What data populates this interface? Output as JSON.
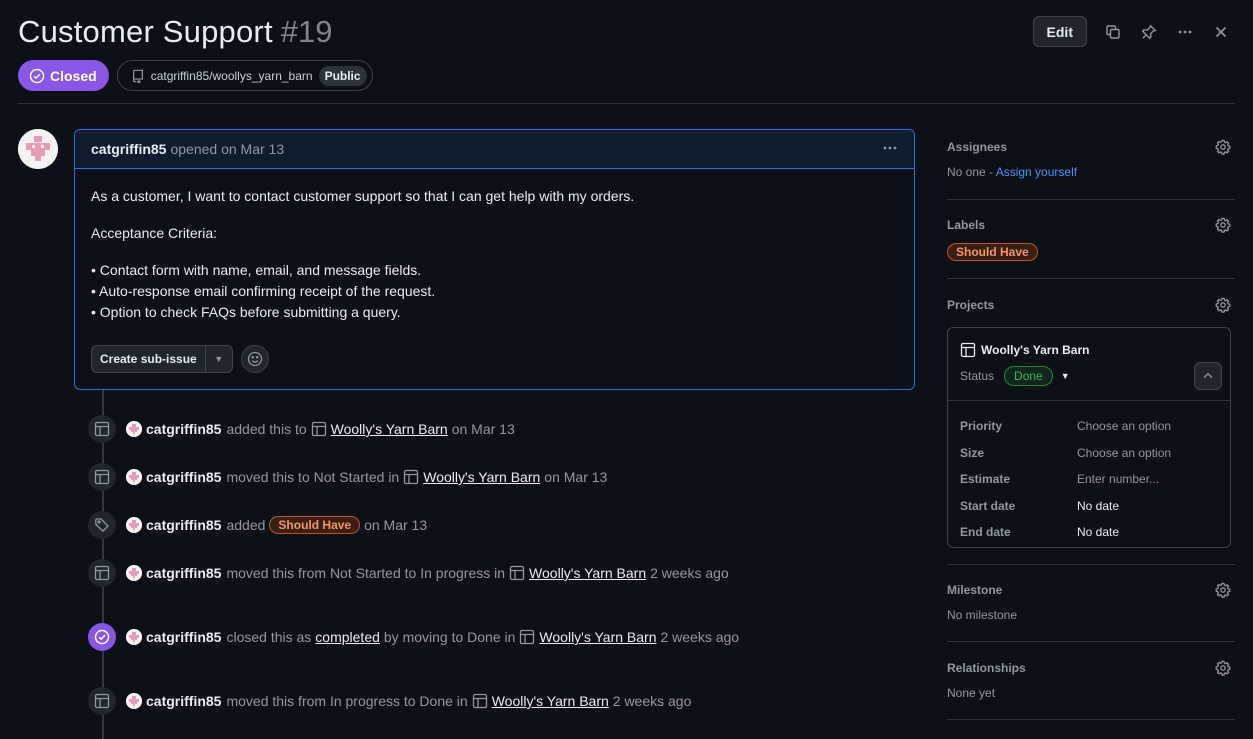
{
  "issue": {
    "title": "Customer Support",
    "number": "#19",
    "state": "Closed",
    "repo": "catgriffin85/woollys_yarn_barn",
    "visibility": "Public"
  },
  "header": {
    "edit_label": "Edit"
  },
  "comment": {
    "author": "catgriffin85",
    "opened_text": "opened on Mar 13",
    "paragraph": "As a customer, I want to contact customer support so that I can get help with my orders.",
    "criteria_heading": "Acceptance Criteria:",
    "criteria": [
      "• Contact form with name, email, and message fields.",
      "• Auto-response email confirming receipt of the request.",
      "• Option to check FAQs before submitting a query."
    ],
    "create_sub_issue_label": "Create sub-issue"
  },
  "timeline": [
    {
      "actor": "catgriffin85",
      "pre": "added this to",
      "project": "Woolly's Yarn Barn",
      "post": "on Mar 13"
    },
    {
      "actor": "catgriffin85",
      "pre": "moved this to Not Started in",
      "project": "Woolly's Yarn Barn",
      "post": "on Mar 13"
    },
    {
      "actor": "catgriffin85",
      "pre": "added",
      "label": "Should Have",
      "post": "on Mar 13"
    },
    {
      "actor": "catgriffin85",
      "pre": "moved this from Not Started to In progress in",
      "project": "Woolly's Yarn Barn",
      "post": "2 weeks ago"
    },
    {
      "actor": "catgriffin85",
      "pre": "closed this as",
      "link": "completed",
      "mid": "by moving to Done in",
      "project": "Woolly's Yarn Barn",
      "post": "2 weeks ago"
    },
    {
      "actor": "catgriffin85",
      "pre": "moved this from In progress to Done in",
      "project": "Woolly's Yarn Barn",
      "post": "2 weeks ago"
    }
  ],
  "sidebar": {
    "assignees": {
      "title": "Assignees",
      "none": "No one -",
      "action": "Assign yourself"
    },
    "labels": {
      "title": "Labels",
      "label": "Should Have"
    },
    "projects": {
      "title": "Projects",
      "name": "Woolly's Yarn Barn",
      "status_label": "Status",
      "status_value": "Done",
      "fields": [
        {
          "name": "Priority",
          "value": "Choose an option"
        },
        {
          "name": "Size",
          "value": "Choose an option"
        },
        {
          "name": "Estimate",
          "value": "Enter number..."
        },
        {
          "name": "Start date",
          "value": "No date"
        },
        {
          "name": "End date",
          "value": "No date"
        }
      ]
    },
    "milestone": {
      "title": "Milestone",
      "value": "No milestone"
    },
    "relationships": {
      "title": "Relationships",
      "value": "None yet"
    }
  },
  "colors": {
    "closed": "#8957e5",
    "link": "#4493f8",
    "label_border": "#b5562b",
    "done": "#3fb950"
  }
}
